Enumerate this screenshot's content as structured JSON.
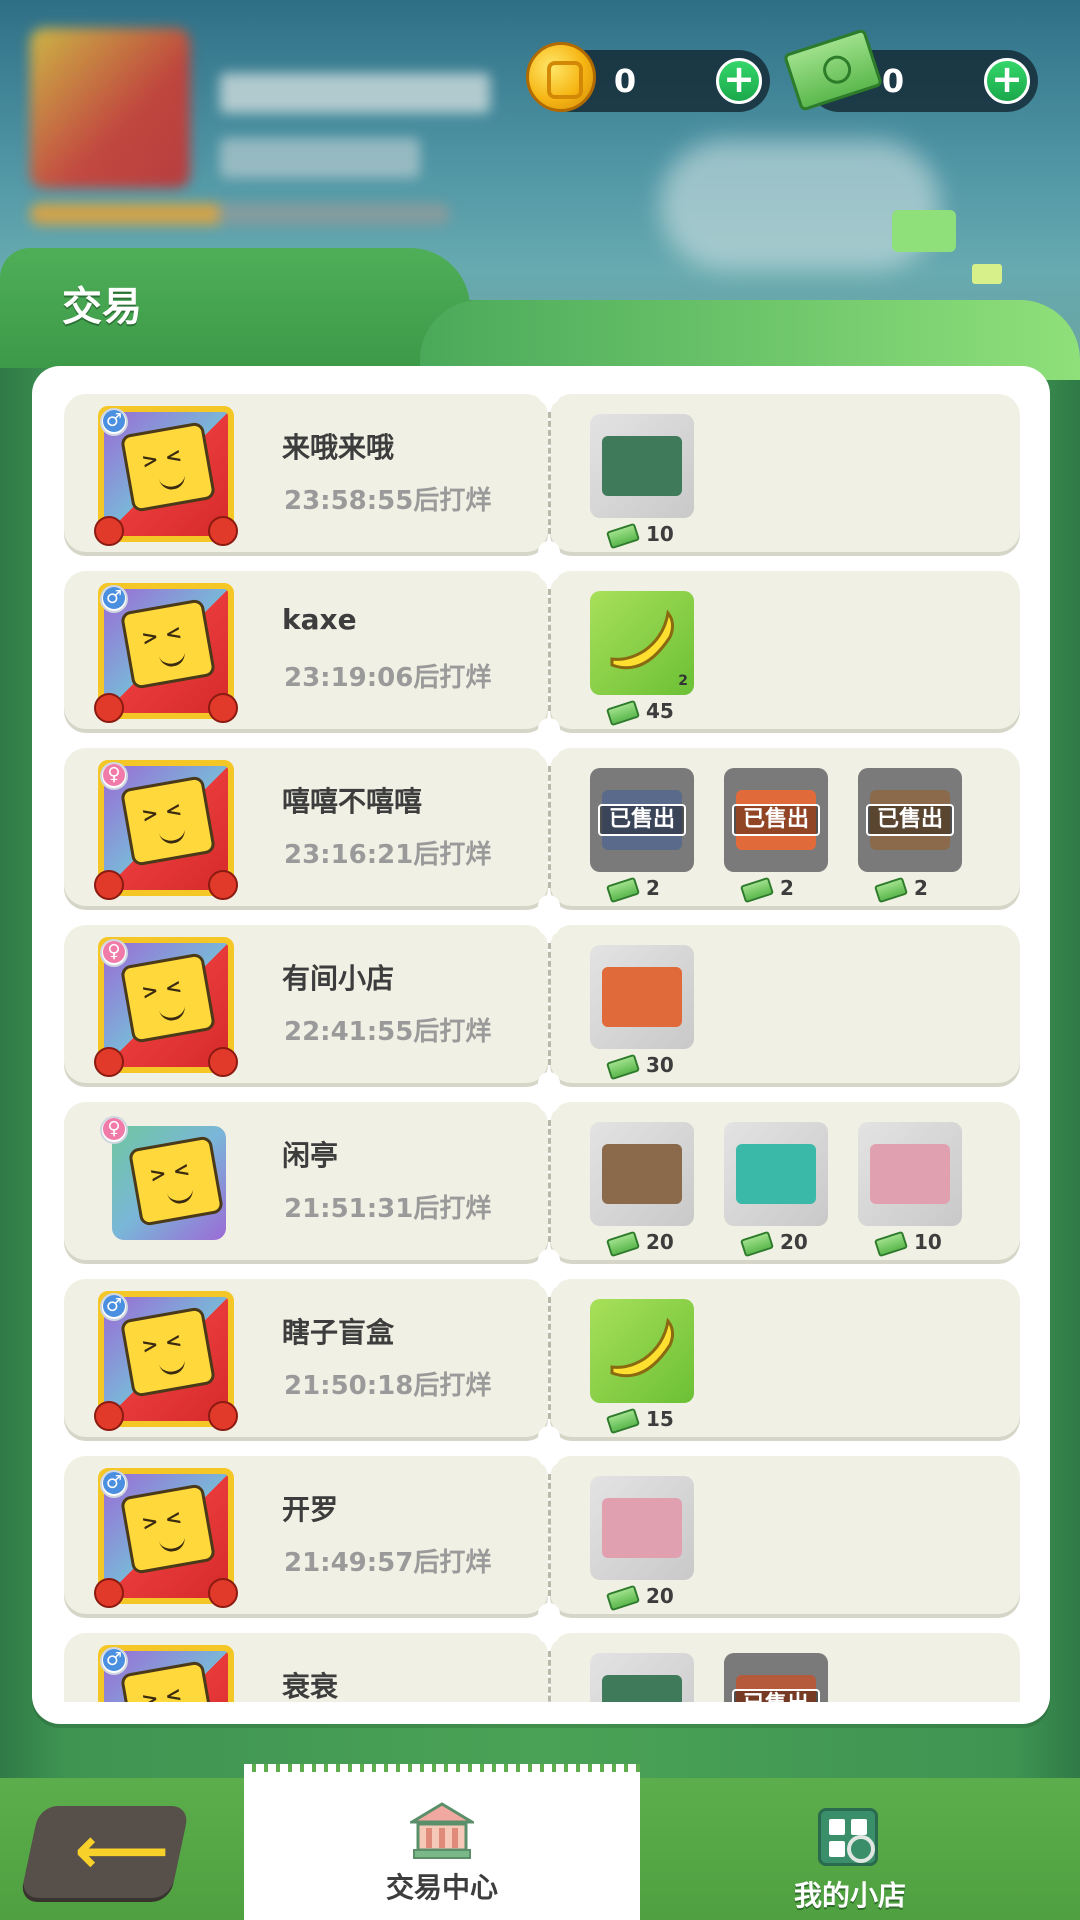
{
  "currencies": [
    {
      "icon": "coin-icon",
      "value": "0"
    },
    {
      "icon": "cash-icon",
      "value": "0"
    }
  ],
  "panel": {
    "title": "交易"
  },
  "trades": [
    {
      "name": "来哦来哦",
      "time": "23:58:55后打烊",
      "gender": "male",
      "items": [
        {
          "type": "building",
          "price": "10",
          "sold": false
        }
      ]
    },
    {
      "name": "kaxe",
      "time": "23:19:06后打烊",
      "gender": "male",
      "items": [
        {
          "type": "banana",
          "price": "45",
          "qty": "2",
          "sold": false
        }
      ]
    },
    {
      "name": "嘻嘻不嘻嘻",
      "time": "23:16:21后打烊",
      "gender": "female",
      "items": [
        {
          "type": "building",
          "price": "2",
          "sold": true,
          "sold_label": "已售出"
        },
        {
          "type": "building",
          "price": "2",
          "sold": true,
          "sold_label": "已售出"
        },
        {
          "type": "building",
          "price": "2",
          "sold": true,
          "sold_label": "已售出"
        }
      ]
    },
    {
      "name": "有间小店",
      "time": "22:41:55后打烊",
      "gender": "female",
      "items": [
        {
          "type": "building",
          "price": "30",
          "sold": false
        }
      ]
    },
    {
      "name": "闲亭",
      "time": "21:51:31后打烊",
      "gender": "female",
      "plain_avatar": true,
      "items": [
        {
          "type": "building",
          "price": "20",
          "sold": false
        },
        {
          "type": "building",
          "price": "20",
          "sold": false
        },
        {
          "type": "building",
          "price": "10",
          "sold": false
        }
      ]
    },
    {
      "name": "瞎子盲盒",
      "time": "21:50:18后打烊",
      "gender": "male",
      "items": [
        {
          "type": "banana",
          "price": "15",
          "sold": false
        }
      ]
    },
    {
      "name": "开罗",
      "time": "21:49:57后打烊",
      "gender": "male",
      "items": [
        {
          "type": "building",
          "price": "20",
          "sold": false
        }
      ]
    },
    {
      "name": "衰衰",
      "time": "",
      "gender": "male",
      "items": [
        {
          "type": "building",
          "price": "",
          "sold": false
        },
        {
          "type": "building",
          "price": "",
          "sold": true,
          "sold_label": "已售出"
        }
      ]
    }
  ],
  "nav": {
    "back_icon": "back-arrow-icon",
    "tabs": [
      {
        "label": "交易中心",
        "icon": "trade-center-icon",
        "active": true
      },
      {
        "label": "我的小店",
        "icon": "my-shop-icon",
        "active": false
      }
    ]
  },
  "colors": {
    "accent_green": "#4aa256",
    "card_bg": "#f0f0e4",
    "plus_green": "#1aa84b",
    "back_yellow": "#f8d02a"
  }
}
